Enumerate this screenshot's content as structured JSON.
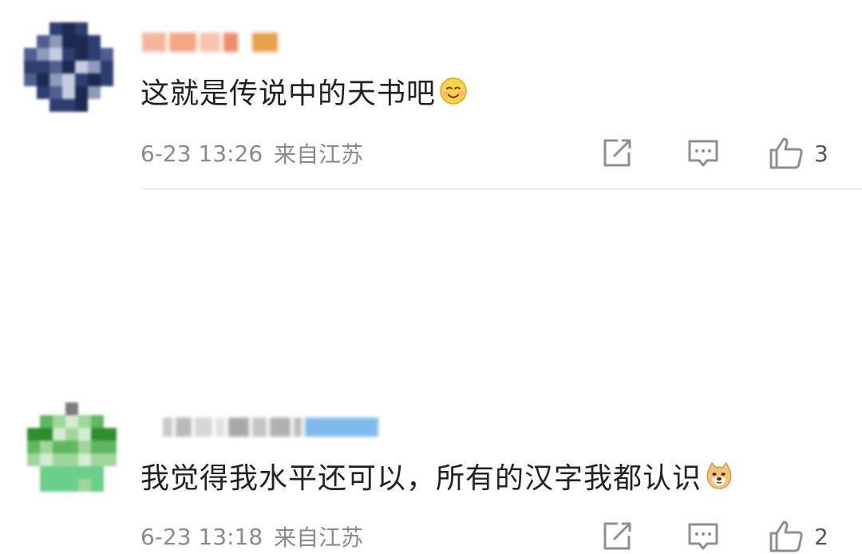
{
  "comments": [
    {
      "text": "这就是传说中的天书吧",
      "emoji": "smile-emoji",
      "time": "6-23 13:26",
      "location": "来自江苏",
      "likes": "3"
    },
    {
      "text": "我觉得我水平还可以，所有的汉字我都认识",
      "emoji": "doge-emoji",
      "time": "6-23 13:18",
      "location": "来自江苏",
      "likes": "2"
    }
  ],
  "colors": {
    "text": "#222222",
    "meta": "#8a8a8a",
    "icon": "#8f8f8f",
    "divider": "#ededed"
  },
  "icons": [
    "share-icon",
    "comment-icon",
    "like-icon"
  ]
}
